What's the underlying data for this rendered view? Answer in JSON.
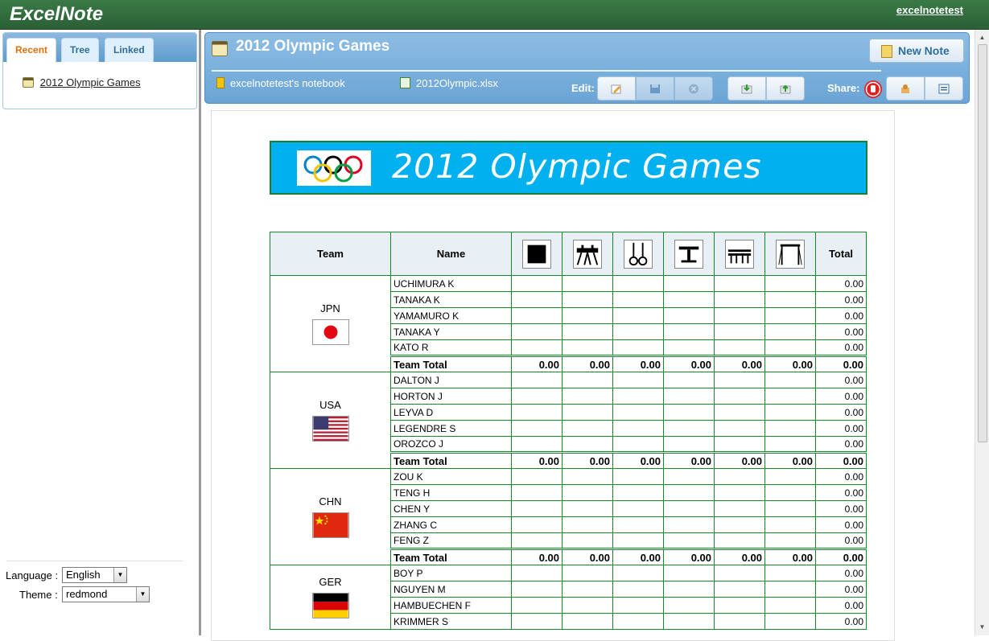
{
  "app": {
    "brand": "ExcelNote",
    "user": "excelnotetest"
  },
  "left": {
    "tabs": [
      "Recent",
      "Tree",
      "Linked"
    ],
    "recent_item": "2012 Olympic Games",
    "language_label": "Language :",
    "language_value": "English",
    "theme_label": "Theme :",
    "theme_value": "redmond"
  },
  "note": {
    "title": "2012 Olympic Games",
    "new_note": "New Note",
    "notebook": "excelnotetest's notebook",
    "file": "2012Olympic.xlsx",
    "edit_label": "Edit:",
    "share_label": "Share:"
  },
  "sheet": {
    "banner_title": "2012 Olympic Games",
    "headers": {
      "team": "Team",
      "name": "Name",
      "total": "Total"
    },
    "events": [
      "floor",
      "pommel-horse",
      "rings",
      "vault",
      "parallel-bars",
      "horizontal-bar"
    ],
    "total_label": "Team Total",
    "teams": [
      {
        "code": "JPN",
        "members": [
          "UCHIMURA K",
          "TANAKA K",
          "YAMAMURO K",
          "TANAKA Y",
          "KATO R"
        ],
        "member_totals": [
          "0.00",
          "0.00",
          "0.00",
          "0.00",
          "0.00"
        ],
        "team_totals": [
          "0.00",
          "0.00",
          "0.00",
          "0.00",
          "0.00",
          "0.00",
          "0.00"
        ]
      },
      {
        "code": "USA",
        "members": [
          "DALTON J",
          "HORTON J",
          "LEYVA D",
          "LEGENDRE S",
          "OROZCO J"
        ],
        "member_totals": [
          "0.00",
          "0.00",
          "0.00",
          "0.00",
          "0.00"
        ],
        "team_totals": [
          "0.00",
          "0.00",
          "0.00",
          "0.00",
          "0.00",
          "0.00",
          "0.00"
        ]
      },
      {
        "code": "CHN",
        "members": [
          "ZOU K",
          "TENG H",
          "CHEN Y",
          "ZHANG C",
          "FENG Z"
        ],
        "member_totals": [
          "0.00",
          "0.00",
          "0.00",
          "0.00",
          "0.00"
        ],
        "team_totals": [
          "0.00",
          "0.00",
          "0.00",
          "0.00",
          "0.00",
          "0.00",
          "0.00"
        ]
      },
      {
        "code": "GER",
        "members": [
          "BOY P",
          "NGUYEN M",
          "HAMBUECHEN F",
          "KRIMMER S"
        ],
        "member_totals": [
          "0.00",
          "0.00",
          "0.00",
          "0.00"
        ],
        "team_totals": []
      }
    ]
  },
  "colors": {
    "brand_green": "#2f6b3a",
    "banner_blue": "#00b0ef",
    "grid_green": "#148a2c",
    "header_blue": "#7ab0de"
  }
}
